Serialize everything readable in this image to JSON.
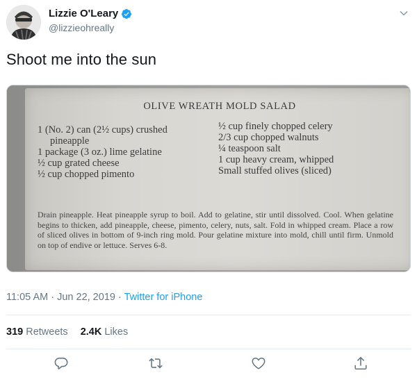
{
  "author": {
    "display_name": "Lizzie O'Leary",
    "handle": "@lizzieohreally",
    "avatar_icon": "avatar-photo",
    "verified_icon": "verified-badge-icon"
  },
  "tweet": {
    "text": "Shoot me into the sun"
  },
  "photo": {
    "title": "OLIVE WREATH MOLD SALAD",
    "ingredients_left": [
      "1 (No. 2) can (2½ cups) crushed",
      "pineapple",
      "1 package (3 oz.) lime gelatine",
      "½ cup grated cheese",
      "½ cup chopped pimento"
    ],
    "ingredients_right": [
      "½ cup finely chopped celery",
      "2/3 cup chopped walnuts",
      "¼ teaspoon salt",
      "1 cup heavy cream, whipped",
      "Small stuffed olives (sliced)"
    ],
    "directions": "Drain pineapple. Heat pineapple syrup to boil. Add to gelatine, stir until dissolved. Cool. When gelatine begins to thicken, add pineapple, cheese, pimento, celery, nuts, salt. Fold in whipped cream. Place a row of sliced olives in bottom of 9-inch ring mold. Pour gelatine mixture into mold, chill until firm. Unmold on top of endive or lettuce. Serves 6-8."
  },
  "meta": {
    "time": "11:05 AM",
    "separator": " · ",
    "date": "Jun 22, 2019",
    "source": "Twitter for iPhone"
  },
  "stats": {
    "retweets_count": "319",
    "retweets_label": "Retweets",
    "likes_count": "2.4K",
    "likes_label": "Likes"
  },
  "actions": {
    "reply_icon": "reply-icon",
    "retweet_icon": "retweet-icon",
    "like_icon": "heart-icon",
    "share_icon": "share-icon"
  },
  "colors": {
    "accent": "#1da1f2",
    "secondary_text": "#657786",
    "primary_text": "#14171a"
  }
}
